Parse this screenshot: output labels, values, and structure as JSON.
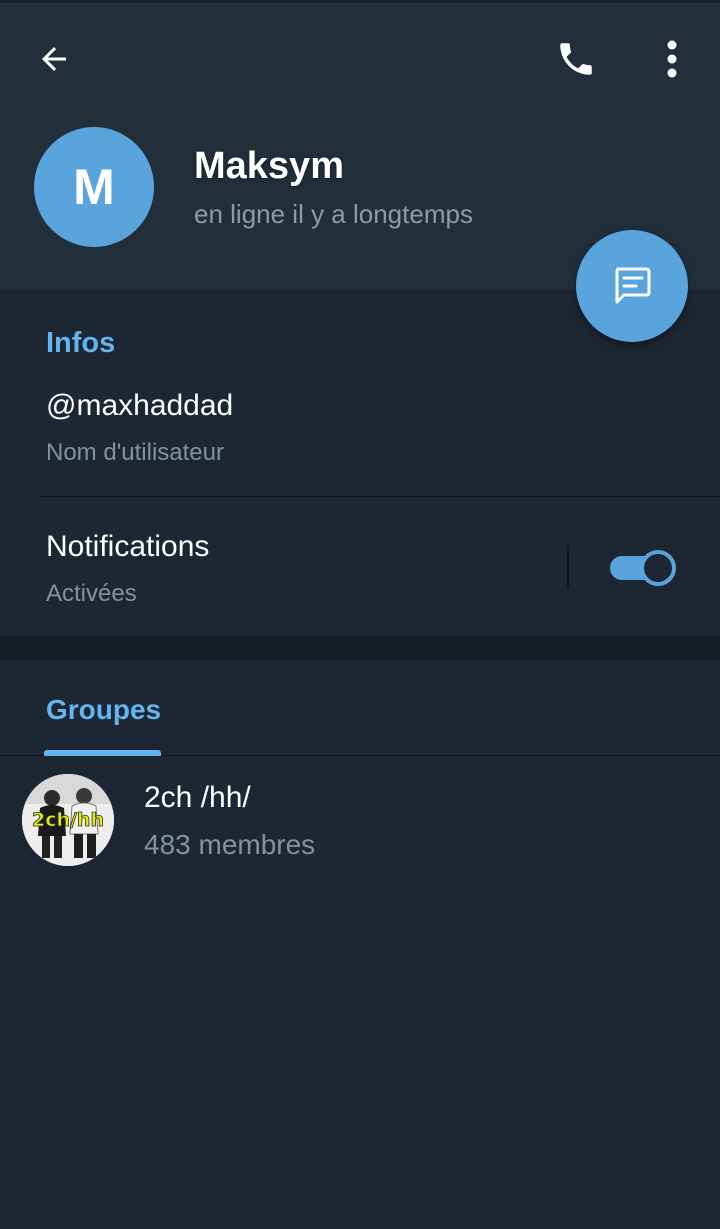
{
  "header": {
    "back_icon": "arrow-left-icon",
    "call_icon": "phone-icon",
    "more_icon": "more-vertical-icon"
  },
  "profile": {
    "avatar_letter": "M",
    "avatar_color": "#5aa4dd",
    "name": "Maksym",
    "status": "en ligne il y a longtemps"
  },
  "fab": {
    "icon": "message-icon"
  },
  "info": {
    "title": "Infos",
    "username": "@maxhaddad",
    "username_label": "Nom d'utilisateur",
    "notifications_label": "Notifications",
    "notifications_status": "Activées",
    "notifications_enabled": true
  },
  "groups_tab": {
    "label": "Groupes"
  },
  "groups": [
    {
      "name": "2ch /hh/",
      "members": "483 membres",
      "avatar_text": "2ch/hh"
    }
  ],
  "colors": {
    "accent": "#5aa4dd",
    "section_title": "#64b5ef",
    "header_bg": "#222f3b",
    "body_bg": "#1d2733"
  }
}
